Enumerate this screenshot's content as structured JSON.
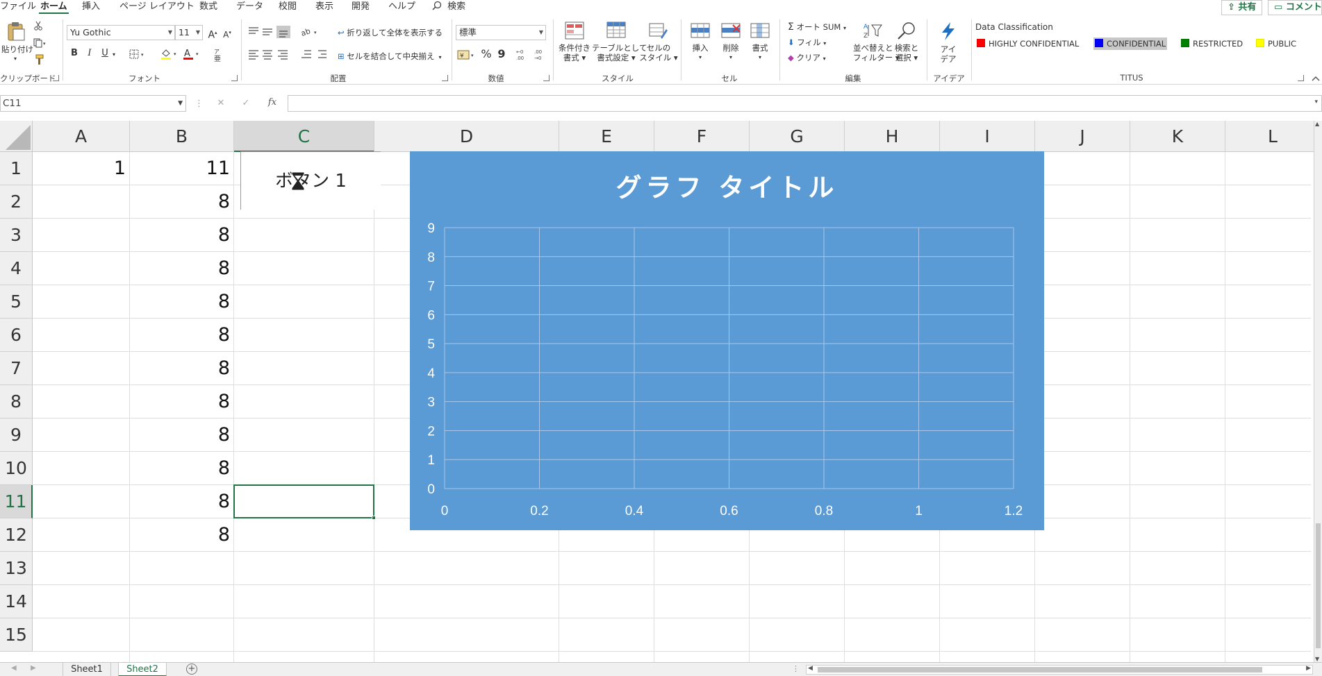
{
  "tabs": {
    "file": "ファイル",
    "home": "ホーム",
    "insert": "挿入",
    "page_layout": "ページ レイアウト",
    "formulas": "数式",
    "data": "データ",
    "review": "校閲",
    "view": "表示",
    "developer": "開発",
    "help": "ヘルプ",
    "search": "検索"
  },
  "share": {
    "share_label": "共有",
    "comment_label": "コメント"
  },
  "ribbon": {
    "clipboard": {
      "paste": "貼り付け",
      "label": "クリップボード"
    },
    "font": {
      "name": "Yu Gothic",
      "size": "11",
      "label": "フォント",
      "bold": "B",
      "italic": "I",
      "underline": "U",
      "grow": "A",
      "shrink": "A"
    },
    "alignment": {
      "wrap": "折り返して全体を表示する",
      "merge": "セルを結合して中央揃え",
      "label": "配置"
    },
    "number": {
      "format": "標準",
      "percent": "%",
      "comma": "9",
      "label": "数値"
    },
    "styles": {
      "conditional": "条件付き",
      "conditional2": "書式",
      "table": "テーブルとして",
      "table2": "書式設定",
      "cell": "セルの",
      "cell2": "スタイル",
      "label": "スタイル"
    },
    "cells": {
      "insert": "挿入",
      "delete": "削除",
      "format": "書式",
      "label": "セル"
    },
    "editing": {
      "autosum": "オート SUM",
      "fill": "フィル",
      "clear": "クリア",
      "sort": "並べ替えと",
      "sort2": "フィルター",
      "find": "検索と",
      "find2": "選択",
      "label": "編集"
    },
    "ideas": {
      "ideas": "アイ",
      "ideas2": "デア",
      "label": "アイデア"
    },
    "titus": {
      "heading": "Data Classification",
      "label": "TITUS",
      "items": [
        {
          "label": "HIGHLY CONFIDENTIAL",
          "color": "#ff0000"
        },
        {
          "label": "CONFIDENTIAL",
          "color": "#0000ff"
        },
        {
          "label": "RESTRICTED",
          "color": "#008000"
        },
        {
          "label": "PUBLIC",
          "color": "#ffff00"
        }
      ]
    }
  },
  "formula_bar": {
    "name_box": "C11",
    "fx": "fx",
    "cancel": "✕",
    "enter": "✓",
    "formula": ""
  },
  "columns": [
    "A",
    "B",
    "C",
    "D",
    "E",
    "F",
    "G",
    "H",
    "I",
    "J",
    "K",
    "L"
  ],
  "rows": [
    "1",
    "2",
    "3",
    "4",
    "5",
    "6",
    "7",
    "8",
    "9",
    "10",
    "11",
    "12",
    "13",
    "14",
    "15"
  ],
  "cells": {
    "A1": "1",
    "B1": "11",
    "B2": "8",
    "B3": "8",
    "B4": "8",
    "B5": "8",
    "B6": "8",
    "B7": "8",
    "B8": "8",
    "B9": "8",
    "B10": "8",
    "B11": "8",
    "B12": "8"
  },
  "active_cell": "C11",
  "form_button": {
    "label": "ボタン 1"
  },
  "chart_data": {
    "type": "scatter",
    "title": "グラフ タイトル",
    "series": [],
    "xlim": [
      0,
      1.2
    ],
    "ylim": [
      0,
      9
    ],
    "x_ticks": [
      "0",
      "0.2",
      "0.4",
      "0.6",
      "0.8",
      "1",
      "1.2"
    ],
    "y_ticks": [
      "0",
      "1",
      "2",
      "3",
      "4",
      "5",
      "6",
      "7",
      "8",
      "9"
    ],
    "grid": true,
    "background": "#5b9bd5"
  },
  "sheets": [
    {
      "name": "Sheet1"
    },
    {
      "name": "Sheet2",
      "active": true
    }
  ]
}
